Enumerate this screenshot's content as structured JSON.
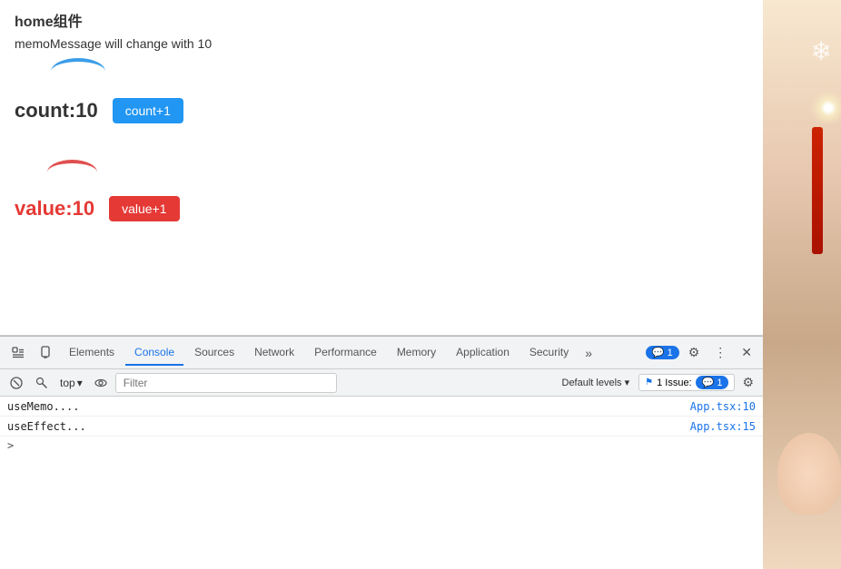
{
  "page": {
    "title": "home组件",
    "memo_message": "memoMessage will change with 10",
    "count_label": "count:10",
    "count_btn": "count+1",
    "value_label": "value:10",
    "value_btn": "value+1"
  },
  "devtools": {
    "tabs": [
      {
        "id": "elements",
        "label": "Elements",
        "active": false
      },
      {
        "id": "console",
        "label": "Console",
        "active": true
      },
      {
        "id": "sources",
        "label": "Sources",
        "active": false
      },
      {
        "id": "network",
        "label": "Network",
        "active": false
      },
      {
        "id": "performance",
        "label": "Performance",
        "active": false
      },
      {
        "id": "memory",
        "label": "Memory",
        "active": false
      },
      {
        "id": "application",
        "label": "Application",
        "active": false
      },
      {
        "id": "security",
        "label": "Security",
        "active": false
      }
    ],
    "badge_count": "1",
    "top_selector": "top",
    "filter_placeholder": "Filter",
    "default_levels": "Default levels",
    "issue_count": "1 Issue:",
    "issue_badge_num": "1",
    "console_rows": [
      {
        "text": "useMemo....",
        "file": "App.tsx:10"
      },
      {
        "text": "useEffect...",
        "file": "App.tsx:15"
      }
    ],
    "prompt": ">"
  }
}
